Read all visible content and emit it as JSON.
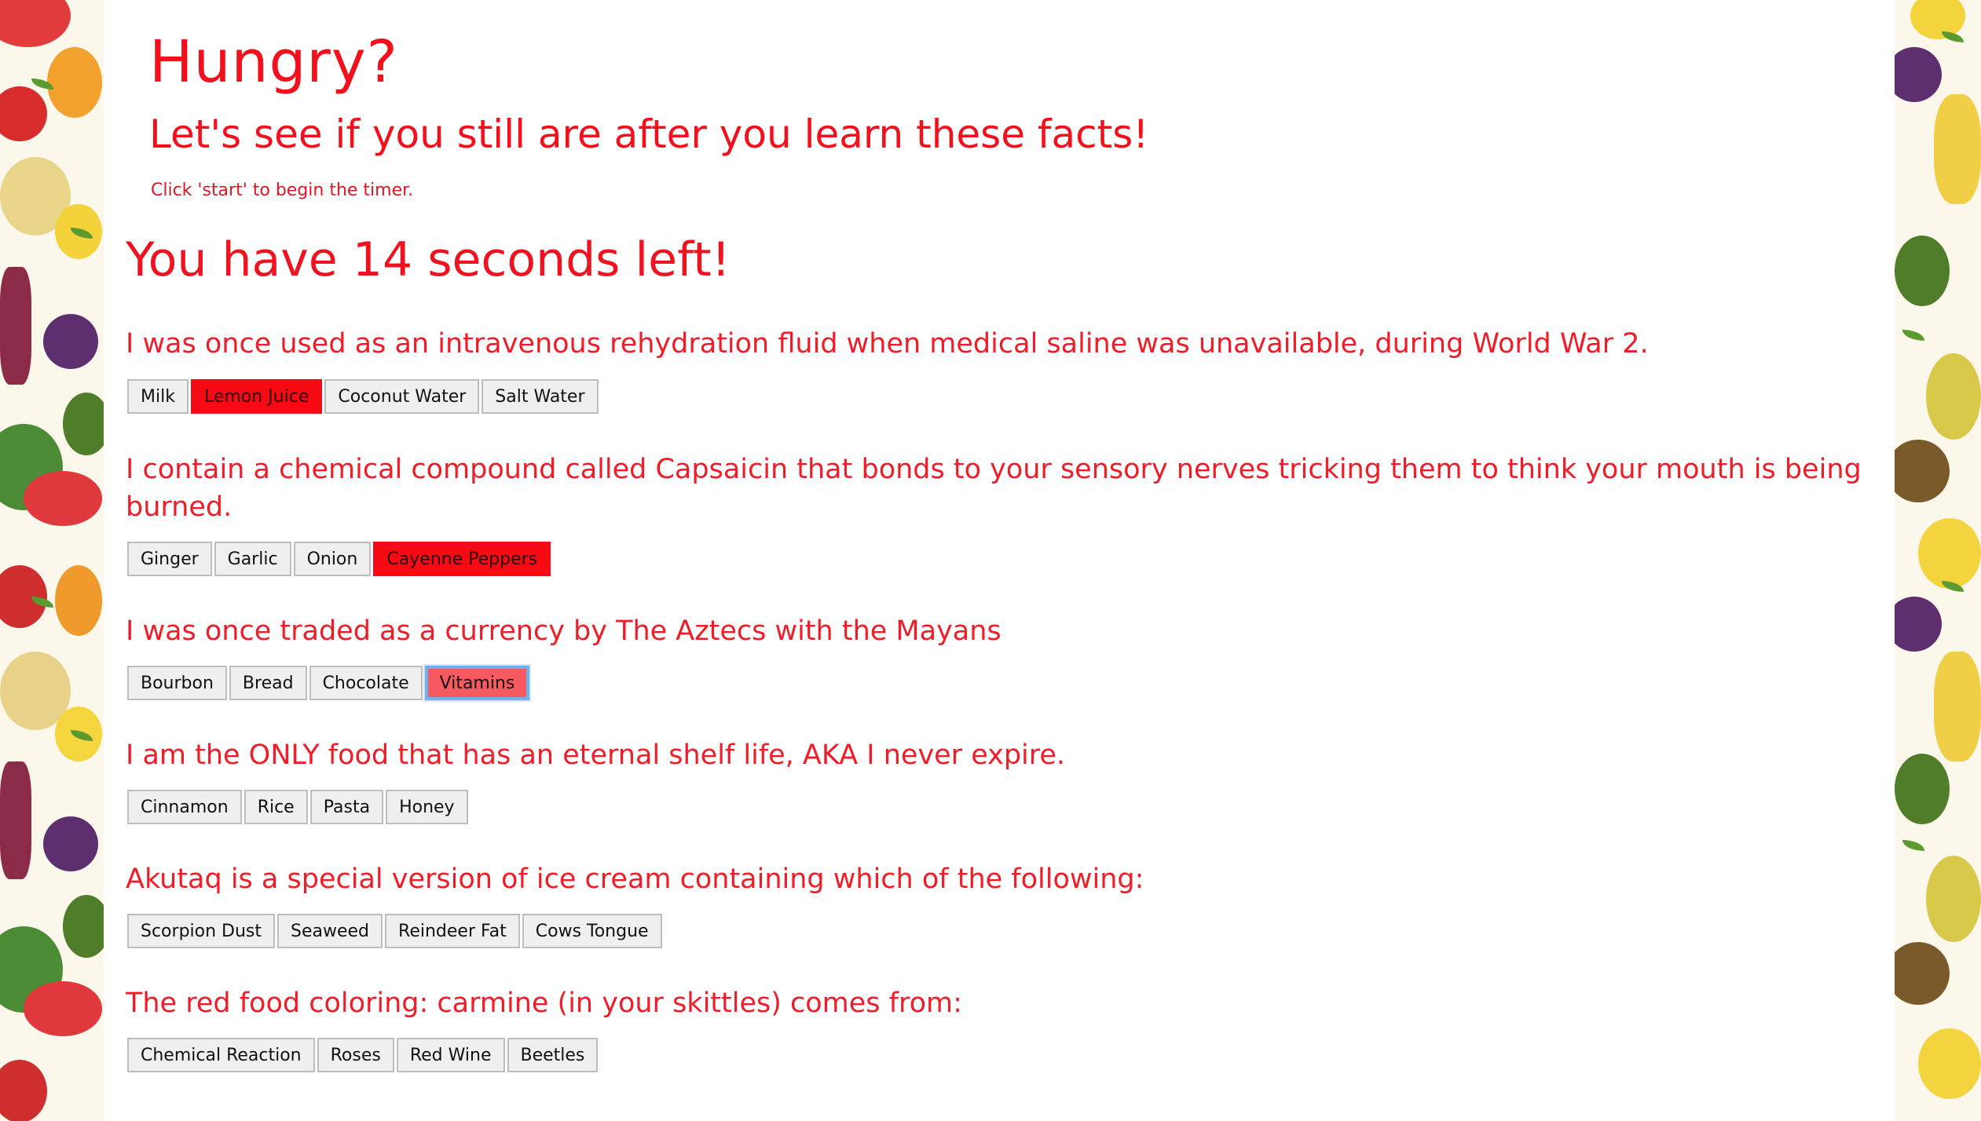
{
  "header": {
    "title": "Hungry?",
    "subtitle": "Let's see if you still are after you learn these facts!",
    "hint": "Click 'start' to begin the timer."
  },
  "timer": {
    "text": "You have 14 seconds left!"
  },
  "questions": [
    {
      "text": "I was once used as an intravenous rehydration fluid when medical saline was unavailable, during World War 2.",
      "answers": [
        "Milk",
        "Lemon Juice",
        "Coconut Water",
        "Salt Water"
      ],
      "selected": "Lemon Juice"
    },
    {
      "text": "I contain a chemical compound called Capsaicin that bonds to your sensory nerves tricking them to think your mouth is being burned.",
      "answers": [
        "Ginger",
        "Garlic",
        "Onion",
        "Cayenne Peppers"
      ],
      "selected": "Cayenne Peppers"
    },
    {
      "text": "I was once traded as a currency by The Aztecs with the Mayans",
      "answers": [
        "Bourbon",
        "Bread",
        "Chocolate",
        "Vitamins"
      ],
      "selected": "Vitamins"
    },
    {
      "text": "I am the ONLY food that has an eternal shelf life, AKA I never expire.",
      "answers": [
        "Cinnamon",
        "Rice",
        "Pasta",
        "Honey"
      ],
      "selected": ""
    },
    {
      "text": "Akutaq is a special version of ice cream containing which of the following:",
      "answers": [
        "Scorpion Dust",
        "Seaweed",
        "Reindeer Fat",
        "Cows Tongue"
      ],
      "selected": ""
    },
    {
      "text": "The red food coloring: carmine (in your skittles) comes from:",
      "answers": [
        "Chemical Reaction",
        "Roses",
        "Red Wine",
        "Beetles"
      ],
      "selected": ""
    }
  ],
  "colors": {
    "accent_text": "#ef1d28",
    "selected_answer": "#f60b15",
    "focused_answer": "#f65a61",
    "focus_ring": "#6fb0ef"
  }
}
